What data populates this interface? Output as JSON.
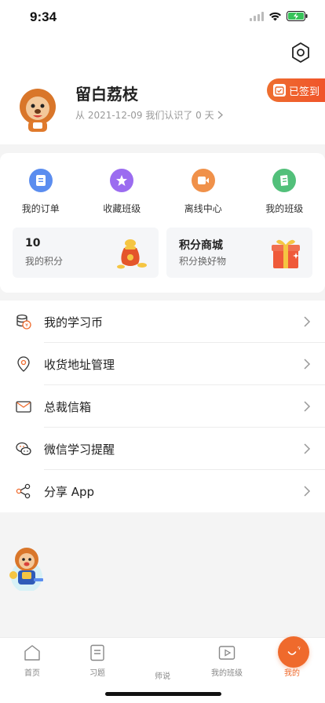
{
  "status_bar": {
    "time": "9:34",
    "icons": [
      "signal-icon",
      "wifi-icon",
      "battery-charging-icon"
    ]
  },
  "header": {
    "user_name": "留白荔枝",
    "since_text": "从 2021-12-09 我们认识了 0 天",
    "checkin_label": "已签到",
    "icons": [
      "settings-icon",
      "avatar-lion",
      "chevron-right-icon",
      "calendar-check-icon"
    ]
  },
  "quick_links": [
    {
      "label": "我的订单",
      "icon": "order-icon",
      "color": "#5b8def"
    },
    {
      "label": "收藏班级",
      "icon": "star-icon",
      "color": "#9b6cf0"
    },
    {
      "label": "离线中心",
      "icon": "video-icon",
      "color": "#f0914a"
    },
    {
      "label": "我的班级",
      "icon": "book-icon",
      "color": "#52c07a"
    }
  ],
  "tiles": [
    {
      "title": "10",
      "subtitle": "我的积分",
      "icon": "money-bag-icon"
    },
    {
      "title": "积分商城",
      "subtitle": "积分换好物",
      "icon": "gift-box-icon"
    }
  ],
  "menu": [
    {
      "label": "我的学习币",
      "icon": "coin-icon"
    },
    {
      "label": "收货地址管理",
      "icon": "location-pin-icon"
    },
    {
      "label": "总裁信箱",
      "icon": "mail-icon"
    },
    {
      "label": "微信学习提醒",
      "icon": "wechat-icon"
    },
    {
      "label": "分享 App",
      "icon": "share-icon"
    }
  ],
  "tabbar": {
    "tabs": [
      {
        "label": "首页",
        "icon": "home-icon",
        "active": false
      },
      {
        "label": "习题",
        "icon": "exercise-icon",
        "active": false
      },
      {
        "label": "师说",
        "icon": "paper-plane-icon",
        "active": false
      },
      {
        "label": "我的班级",
        "icon": "play-icon",
        "active": false
      },
      {
        "label": "我的",
        "icon": "smile-icon",
        "active": true
      }
    ]
  },
  "colors": {
    "accent": "#ef6a2c",
    "inactive": "#888888",
    "background": "#f4f4f4"
  }
}
